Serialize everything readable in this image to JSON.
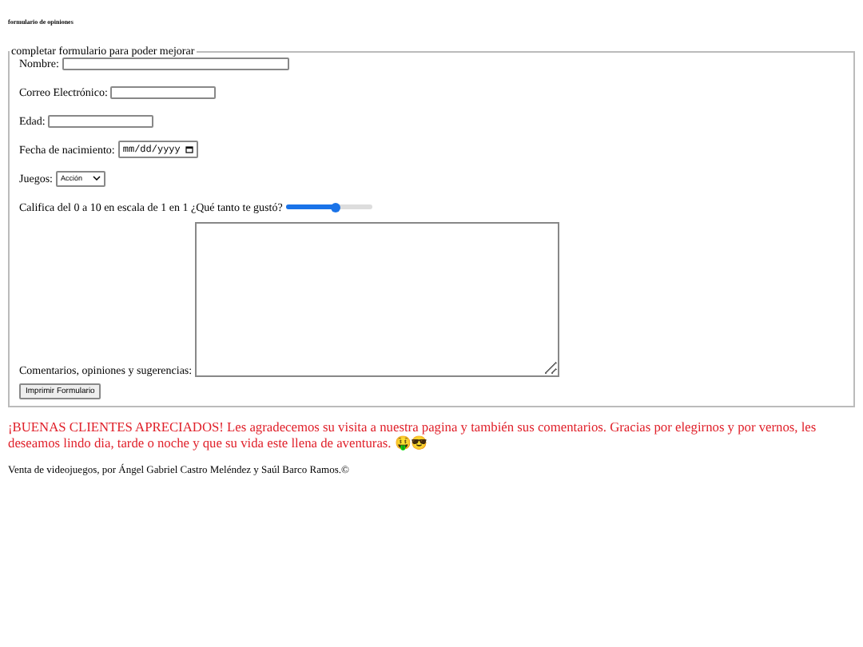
{
  "page_title": "formulario de opiniones",
  "form": {
    "legend": "completar formulario para poder mejorar",
    "fields": [
      {
        "kind": "text",
        "label": "Nombre:"
      },
      {
        "kind": "email",
        "label": "Correo Electrónico:"
      },
      {
        "kind": "number",
        "label": "Edad:"
      },
      {
        "kind": "date",
        "label": "Fecha de nacimiento:",
        "placeholder": "mm/dd/yyyy"
      },
      {
        "kind": "select",
        "label": "Juegos:",
        "value": "Acción"
      },
      {
        "kind": "range",
        "label": "Califica del 0 a 10 en escala de 1 en 1 ¿Qué tanto te gustó?",
        "level": 0.57
      },
      {
        "kind": "textarea",
        "label": "Comentarios, opiniones y sugerencias:"
      }
    ],
    "submit": "Imprimir Formulario"
  },
  "message": "¡BUENAS CLIENTES APRECIADOS! Les agradecemos su visita a nuestra pagina y también sus comentarios. Gracias por elegirnos y por vernos, les deseamos lindo dia, tarde o noche y que su vida este llena de aventuras. 🤑😎",
  "footer": "Venta de videojuegos, por Ángel Gabriel Castro Meléndez y Saúl Barco Ramos.©"
}
